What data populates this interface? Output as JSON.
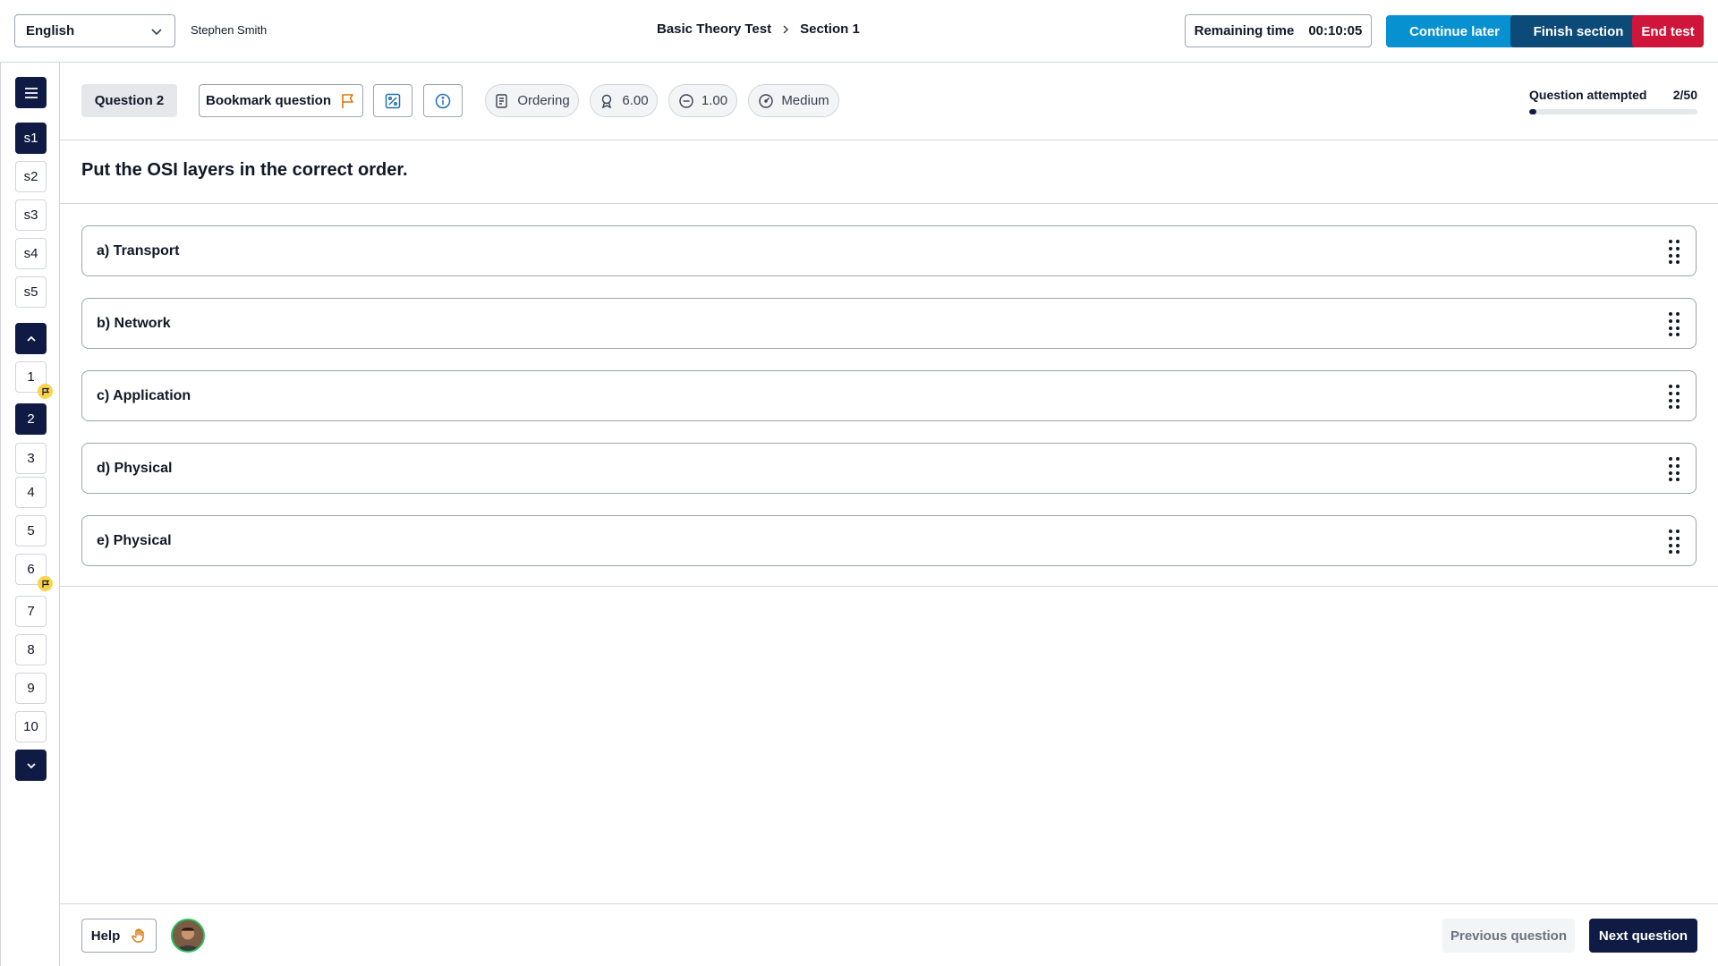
{
  "header": {
    "language": "English",
    "user_name": "Stephen Smith",
    "breadcrumb": [
      "Basic Theory Test",
      "Section 1"
    ],
    "remaining_time_label": "Remaining time",
    "remaining_time": "00:10:05",
    "continue_later": "Continue later",
    "finish_section": "Finish section",
    "end_test": "End test"
  },
  "sidebar": {
    "sections": [
      "s1",
      "s2",
      "s3",
      "s4",
      "s5"
    ],
    "active_section": "s1",
    "questions": [
      {
        "label": "1",
        "bookmarked": true
      },
      {
        "label": "2",
        "current": true
      },
      {
        "label": "3"
      },
      {
        "label": "4"
      },
      {
        "label": "5"
      },
      {
        "label": "6",
        "bookmarked": true
      },
      {
        "label": "7"
      },
      {
        "label": "8"
      },
      {
        "label": "9"
      },
      {
        "label": "10"
      }
    ]
  },
  "question_bar": {
    "question_label": "Question 2",
    "bookmark_label": "Bookmark question",
    "type": "Ordering",
    "score": "6.00",
    "negative": "1.00",
    "difficulty": "Medium",
    "attempted_label": "Question attempted",
    "attempted_value": "2/50",
    "attempted_fraction": 0.04
  },
  "question": {
    "prompt": "Put the OSI layers in the correct order.",
    "options": [
      "a) Transport",
      "b) Network",
      "c) Application",
      "d) Physical",
      "e) Physical"
    ]
  },
  "footer": {
    "help_label": "Help",
    "previous_label": "Previous question",
    "next_label": "Next question"
  },
  "colors": {
    "navy": "#0f1b44",
    "continue_blue": "#0891d1",
    "finish_blue": "#0c4a78",
    "end_red": "#d0153b",
    "bookmark_orange": "#d97706",
    "badge_yellow": "#fcd34d"
  }
}
